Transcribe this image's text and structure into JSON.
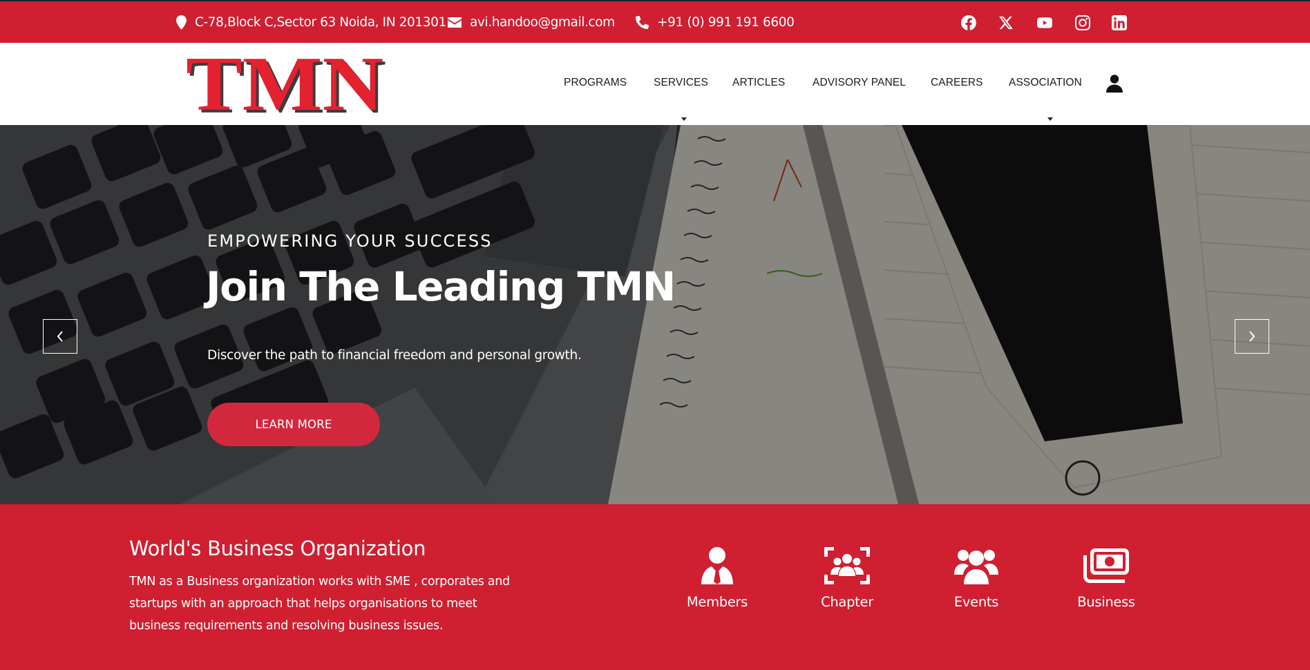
{
  "topbar": {
    "address": "C-78,Block C,Sector 63 Noida, IN 201301",
    "email": "avi.handoo@gmail.com",
    "phone": "+91 (0) 991 191 6600",
    "icons": [
      "location-pin-icon",
      "envelope-icon",
      "phone-icon"
    ],
    "social": [
      "facebook-icon",
      "x-icon",
      "youtube-icon",
      "instagram-icon",
      "linkedin-icon"
    ]
  },
  "header": {
    "logo_text": "TMN",
    "nav": [
      {
        "label": "PROGRAMS",
        "dropdown": false
      },
      {
        "label": "SERVICES",
        "dropdown": true
      },
      {
        "label": "ARTICLES",
        "dropdown": false
      },
      {
        "label": "ADVISORY PANEL",
        "dropdown": false
      },
      {
        "label": "CAREERS",
        "dropdown": false
      },
      {
        "label": "ASSOCIATION",
        "dropdown": true
      }
    ],
    "account_icon": "user-icon"
  },
  "hero": {
    "eyebrow": "EMPOWERING YOUR SUCCESS",
    "title": "Join The Leading TMN",
    "subtitle": "Discover the path to financial freedom and personal growth.",
    "button_label": "LEARN MORE",
    "prev_icon": "chevron-left-icon",
    "next_icon": "chevron-right-icon"
  },
  "band": {
    "title": "World's Business Organization",
    "description": "TMN as a Business organization works with SME , corporates and startups with an approach that helps organisations to meet business requirements and resolving business issues.",
    "features": [
      {
        "label": "Members",
        "icon": "member-icon"
      },
      {
        "label": "Chapter",
        "icon": "group-icon"
      },
      {
        "label": "Events",
        "icon": "users-icon"
      },
      {
        "label": "Business",
        "icon": "money-icon"
      }
    ]
  },
  "colors": {
    "brand_red": "#cf1f31",
    "button_red": "#d2283d",
    "white": "#ffffff",
    "nav_text": "#1a1a1a"
  }
}
